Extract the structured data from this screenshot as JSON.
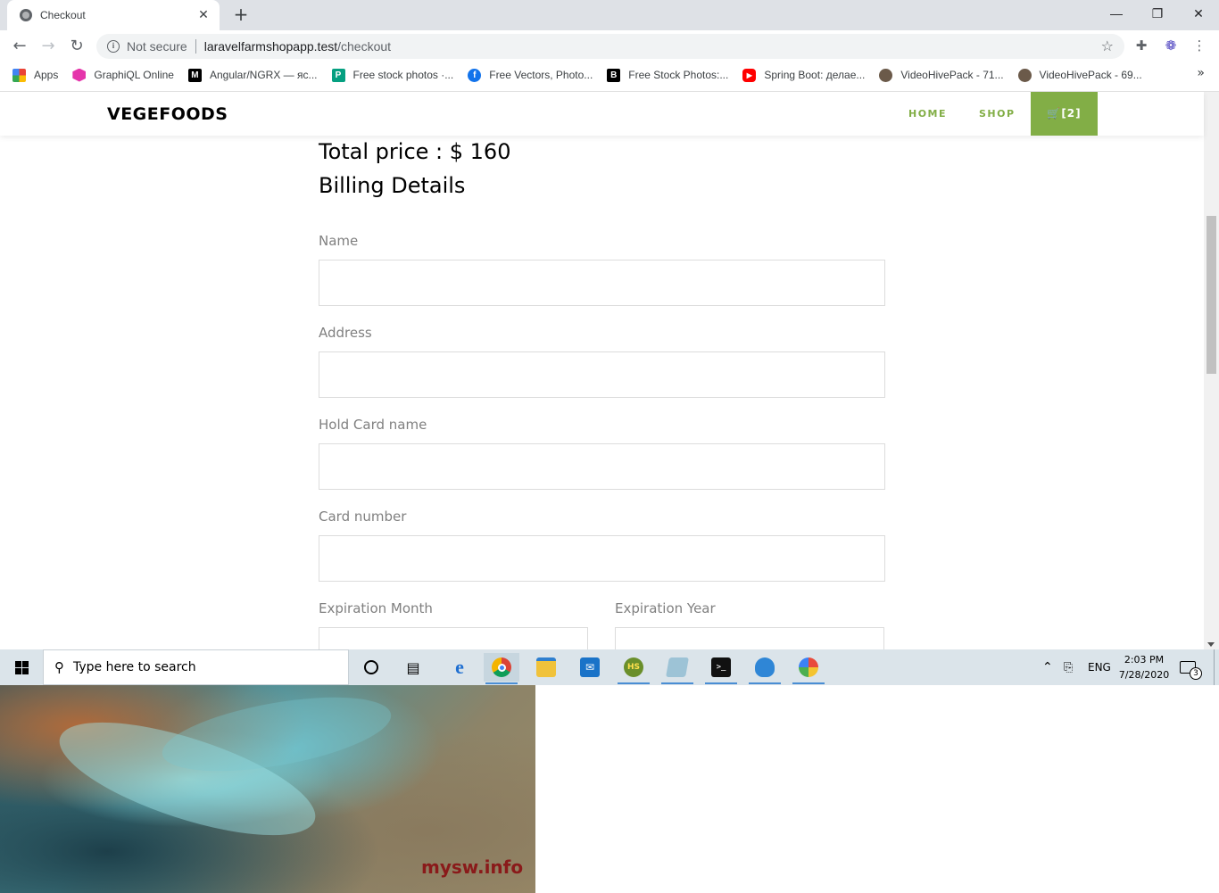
{
  "browser": {
    "tab_title": "Checkout",
    "tab_close": "✕",
    "new_tab": "+",
    "security_label": "Not secure",
    "url_host": "laravelfarmshopapp.test",
    "url_path": "/checkout",
    "window_controls": {
      "minimize": "—",
      "restore": "❐",
      "close": "✕"
    },
    "bookmarks": [
      {
        "label": "Apps",
        "icon": "apps-grid-icon",
        "color": "#4285f4"
      },
      {
        "label": "GraphiQL Online",
        "icon": "graphql-icon",
        "color": "#e535ab"
      },
      {
        "label": "Angular/NGRX — яс...",
        "icon": "medium-icon",
        "color": "#000000"
      },
      {
        "label": "Free stock photos ·...",
        "icon": "pexels-icon",
        "color": "#05a081"
      },
      {
        "label": "Free Vectors, Photo...",
        "icon": "freepik-icon",
        "color": "#1273eb"
      },
      {
        "label": "Free Stock Photos:...",
        "icon": "burst-icon",
        "color": "#000000"
      },
      {
        "label": "Spring Boot: делае...",
        "icon": "youtube-icon",
        "color": "#ff0000"
      },
      {
        "label": "VideoHivePack - 71...",
        "icon": "videohive-icon",
        "color": "#6b5a4a"
      },
      {
        "label": "VideoHivePack - 69...",
        "icon": "videohive-icon",
        "color": "#6b5a4a"
      }
    ],
    "bookmarks_more": "»"
  },
  "site": {
    "brand": "VEGEFOODS",
    "nav": {
      "home": "HOME",
      "shop": "SHOP",
      "cart": "[2]"
    },
    "accent": "#82ae46"
  },
  "checkout": {
    "total": "Total price : $ 160",
    "heading": "Billing Details",
    "fields": {
      "name": {
        "label": "Name",
        "value": ""
      },
      "address": {
        "label": "Address",
        "value": ""
      },
      "card_name": {
        "label": "Hold Card name",
        "value": ""
      },
      "card_number": {
        "label": "Card number",
        "value": ""
      },
      "exp_month": {
        "label": "Expiration Month",
        "value": ""
      },
      "exp_year": {
        "label": "Expiration Year",
        "value": ""
      }
    }
  },
  "taskbar": {
    "search_placeholder": "Type here to search",
    "language": "ENG",
    "time": "2:03 PM",
    "date": "7/28/2020",
    "notifications": "3"
  },
  "wallpaper": {
    "watermark": "mysw.info"
  }
}
